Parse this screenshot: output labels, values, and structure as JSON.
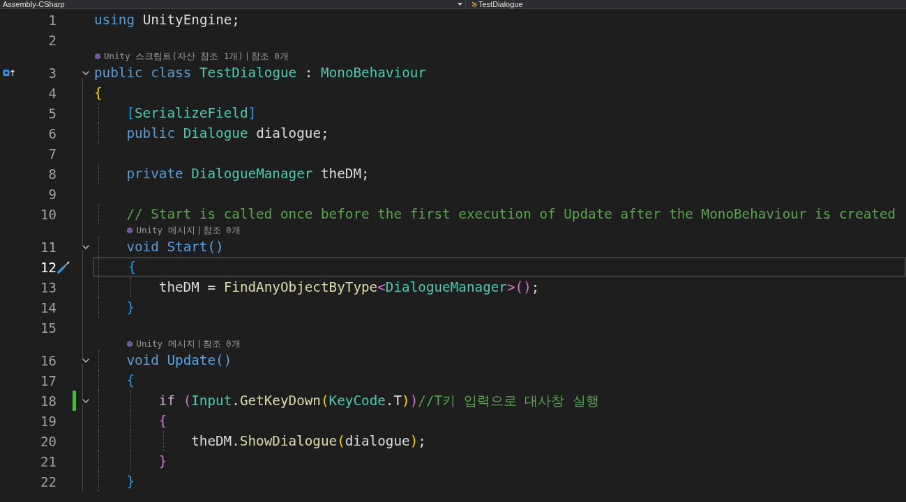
{
  "navigation_bar": {
    "project": "Assembly-CSharp",
    "member": "TestDialogue"
  },
  "lines": [
    {
      "number": "1",
      "current": false,
      "tokens": [
        {
          "text": "using ",
          "kind": "keyword"
        },
        {
          "text": "UnityEngine;",
          "kind": "plain"
        }
      ]
    },
    {
      "number": "2",
      "current": false
    },
    {
      "number": "3",
      "current": false,
      "glyph": {
        "kind": "inheritance"
      },
      "fold": {
        "expanded": true
      },
      "lens": {
        "label": "Unity 스크립트(자산 참조 1개)",
        "references": "참조 0개"
      },
      "tokens": [
        {
          "text": "public class ",
          "kind": "keyword"
        },
        {
          "text": "TestDialogue",
          "kind": "type"
        },
        {
          "text": " : ",
          "kind": "plain"
        },
        {
          "text": "MonoBehaviour",
          "kind": "type"
        }
      ]
    },
    {
      "number": "4",
      "current": false,
      "tokens": [
        {
          "text": "{",
          "kind": "gold"
        }
      ]
    },
    {
      "number": "5",
      "current": false,
      "tokens": [
        {
          "text": "    [",
          "kind": "blue"
        },
        {
          "text": "SerializeField",
          "kind": "type"
        },
        {
          "text": "]",
          "kind": "blue"
        }
      ]
    },
    {
      "number": "6",
      "current": false,
      "tokens": [
        {
          "text": "    public ",
          "kind": "keyword"
        },
        {
          "text": "Dialogue",
          "kind": "type"
        },
        {
          "text": " dialogue;",
          "kind": "plain"
        }
      ]
    },
    {
      "number": "7",
      "current": false
    },
    {
      "number": "8",
      "current": false,
      "tokens": [
        {
          "text": "    private ",
          "kind": "keyword"
        },
        {
          "text": "DialogueManager",
          "kind": "type"
        },
        {
          "text": " theDM;",
          "kind": "plain"
        }
      ]
    },
    {
      "number": "9",
      "current": false
    },
    {
      "number": "10",
      "current": false,
      "tokens": [
        {
          "text": "    // Start is called once before the first execution of Update after the MonoBehaviour is created",
          "kind": "comment"
        }
      ]
    },
    {
      "number": "11",
      "current": false,
      "fold": {
        "expanded": true
      },
      "lens": {
        "label": "Unity 메시지",
        "references": "참조 0개"
      },
      "tokens": [
        {
          "text": "    void ",
          "kind": "keyword"
        },
        {
          "text": "Start()",
          "kind": "decl"
        }
      ]
    },
    {
      "number": "12",
      "current": true,
      "glyph": {
        "kind": "quick-action"
      },
      "tokens": [
        {
          "text": "    {",
          "kind": "blue"
        }
      ]
    },
    {
      "number": "13",
      "current": false,
      "tokens": [
        {
          "text": "        theDM = ",
          "kind": "plain"
        },
        {
          "text": "FindAnyObjectByType",
          "kind": "method"
        },
        {
          "text": "<",
          "kind": "pink"
        },
        {
          "text": "DialogueManager",
          "kind": "type"
        },
        {
          "text": ">()",
          "kind": "pink"
        },
        {
          "text": ";",
          "kind": "plain"
        }
      ]
    },
    {
      "number": "14",
      "current": false,
      "tokens": [
        {
          "text": "    }",
          "kind": "blue"
        }
      ]
    },
    {
      "number": "15",
      "current": false
    },
    {
      "number": "16",
      "current": false,
      "fold": {
        "expanded": true
      },
      "lens": {
        "label": "Unity 메시지",
        "references": "참조 0개"
      },
      "tokens": [
        {
          "text": "    void ",
          "kind": "keyword"
        },
        {
          "text": "Update()",
          "kind": "decl"
        }
      ]
    },
    {
      "number": "17",
      "current": false,
      "tokens": [
        {
          "text": "    {",
          "kind": "blue"
        }
      ]
    },
    {
      "number": "18",
      "current": false,
      "changed": true,
      "fold": {
        "expanded": true
      },
      "tokens": [
        {
          "text": "        if ",
          "kind": "control"
        },
        {
          "text": "(",
          "kind": "pink"
        },
        {
          "text": "Input",
          "kind": "type"
        },
        {
          "text": ".",
          "kind": "plain"
        },
        {
          "text": "GetKeyDown",
          "kind": "method"
        },
        {
          "text": "(",
          "kind": "gold"
        },
        {
          "text": "KeyCode",
          "kind": "type"
        },
        {
          "text": ".T",
          "kind": "plain"
        },
        {
          "text": ")",
          "kind": "gold"
        },
        {
          "text": ")",
          "kind": "pink"
        },
        {
          "text": "//T키 입력으로 대사창 실행",
          "kind": "comment"
        }
      ]
    },
    {
      "number": "19",
      "current": false,
      "tokens": [
        {
          "text": "        {",
          "kind": "pink"
        }
      ]
    },
    {
      "number": "20",
      "current": false,
      "tokens": [
        {
          "text": "            theDM.",
          "kind": "plain"
        },
        {
          "text": "ShowDialogue",
          "kind": "method"
        },
        {
          "text": "(",
          "kind": "gold"
        },
        {
          "text": "dialogue",
          "kind": "plain"
        },
        {
          "text": ")",
          "kind": "gold"
        },
        {
          "text": ";",
          "kind": "plain"
        }
      ]
    },
    {
      "number": "21",
      "current": false,
      "tokens": [
        {
          "text": "        }",
          "kind": "pink"
        }
      ]
    },
    {
      "number": "22",
      "current": false,
      "tokens": [
        {
          "text": "    }",
          "kind": "blue"
        }
      ]
    }
  ]
}
